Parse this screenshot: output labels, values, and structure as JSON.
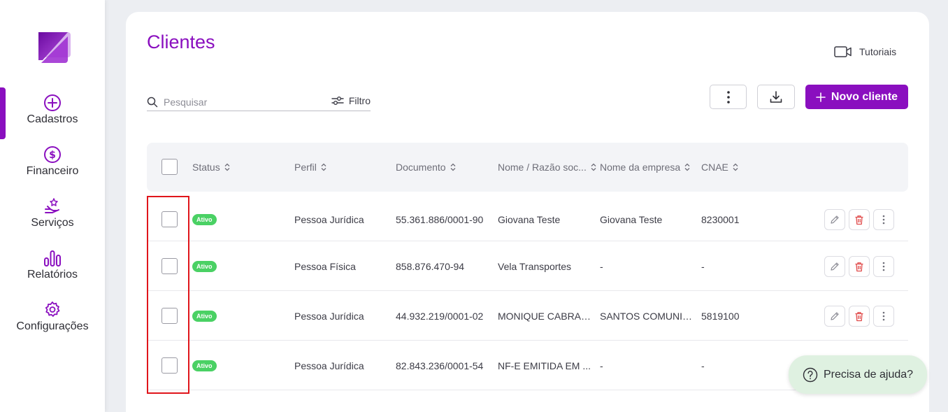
{
  "sidebar": {
    "items": [
      {
        "label": "Cadastros",
        "icon": "plus-circle-icon",
        "active": true
      },
      {
        "label": "Financeiro",
        "icon": "dollar-circle-icon"
      },
      {
        "label": "Serviços",
        "icon": "hand-star-icon"
      },
      {
        "label": "Relatórios",
        "icon": "bar-chart-icon"
      },
      {
        "label": "Configurações",
        "icon": "gear-icon"
      }
    ]
  },
  "header": {
    "title": "Clientes",
    "tutorials_label": "Tutoriais"
  },
  "toolbar": {
    "search_placeholder": "Pesquisar",
    "filter_label": "Filtro",
    "new_client_label": "Novo cliente"
  },
  "table": {
    "columns": [
      "Status",
      "Perfil",
      "Documento",
      "Nome / Razão soc...",
      "Nome da empresa",
      "CNAE"
    ],
    "rows": [
      {
        "status": "Ativo",
        "perfil": "Pessoa Jurídica",
        "documento": "55.361.886/0001-90",
        "nome": "Giovana Teste",
        "empresa": "Giovana Teste",
        "cnae": "8230001"
      },
      {
        "status": "Ativo",
        "perfil": "Pessoa Física",
        "documento": "858.876.470-94",
        "nome": "Vela Transportes",
        "empresa": "-",
        "cnae": "-"
      },
      {
        "status": "Ativo",
        "perfil": "Pessoa Jurídica",
        "documento": "44.932.219/0001-02",
        "nome": "MONIQUE CABRAL...",
        "empresa": "SANTOS COMUNIC...",
        "cnae": "5819100"
      },
      {
        "status": "Ativo",
        "perfil": "Pessoa Jurídica",
        "documento": "82.843.236/0001-54",
        "nome": "NF-E EMITIDA EM ...",
        "empresa": "-",
        "cnae": "-"
      }
    ]
  },
  "help": {
    "label": "Precisa de ajuda?"
  },
  "colors": {
    "accent": "#8a0fbf",
    "status_active": "#4ad164",
    "delete": "#e04b4b",
    "highlight": "#e0151b"
  }
}
